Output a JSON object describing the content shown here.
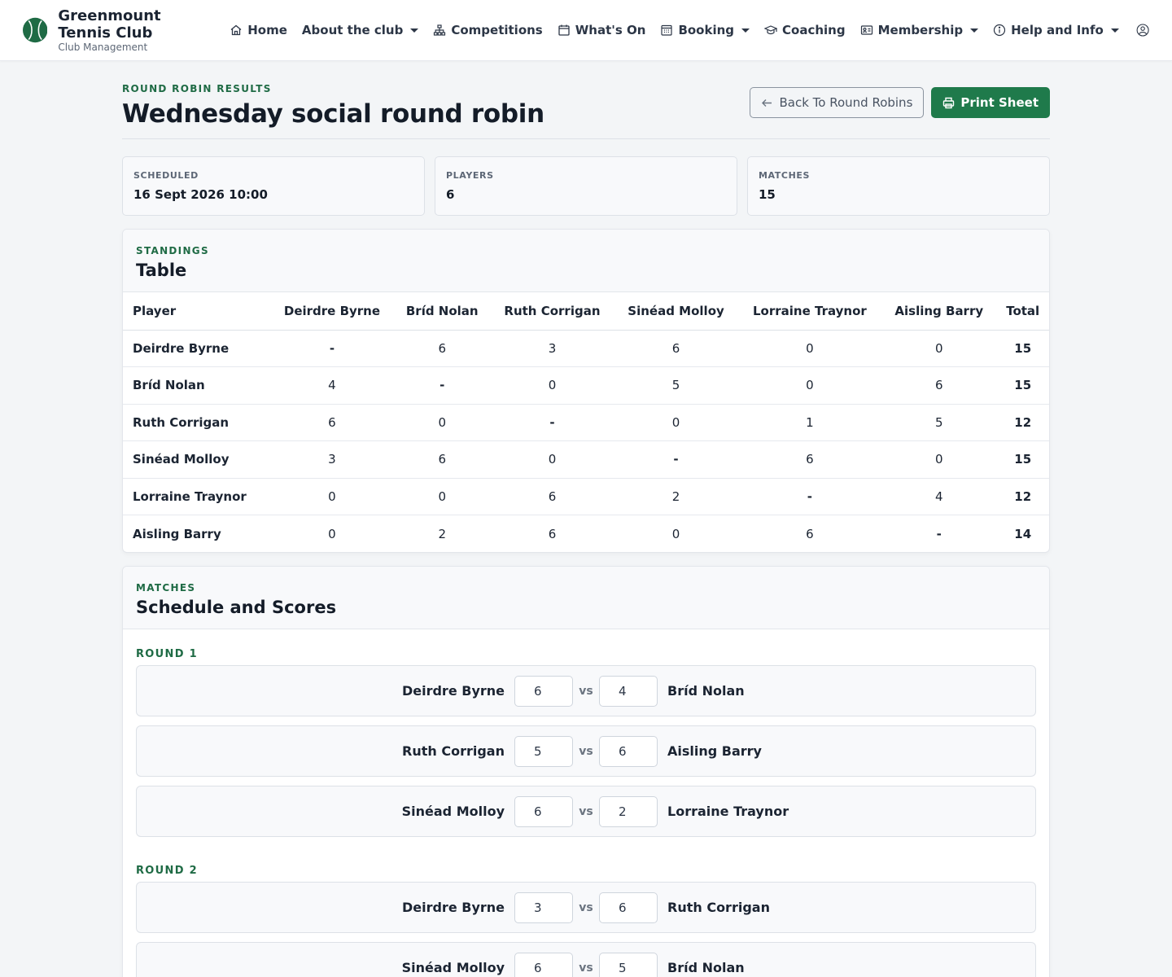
{
  "brand": {
    "title": "Greenmount Tennis Club",
    "subtitle": "Club Management"
  },
  "nav": {
    "home": "Home",
    "about": "About the club",
    "competitions": "Competitions",
    "whats_on": "What's On",
    "booking": "Booking",
    "coaching": "Coaching",
    "membership": "Membership",
    "help": "Help and Info"
  },
  "page": {
    "eyebrow": "Round Robin Results",
    "title": "Wednesday social round robin",
    "back_label": "Back To Round Robins",
    "print_label": "Print Sheet"
  },
  "stats": {
    "scheduled_label": "Scheduled",
    "scheduled_value": "16 Sept 2026 10:00",
    "players_label": "Players",
    "players_value": "6",
    "matches_label": "Matches",
    "matches_value": "15"
  },
  "standings": {
    "eyebrow": "Standings",
    "title": "Table",
    "player_header": "Player",
    "total_header": "Total",
    "columns": [
      "Deirdre Byrne",
      "Bríd Nolan",
      "Ruth Corrigan",
      "Sinéad Molloy",
      "Lorraine Traynor",
      "Aisling Barry"
    ],
    "rows": [
      {
        "player": "Deirdre Byrne",
        "scores": [
          "-",
          "6",
          "3",
          "6",
          "0",
          "0"
        ],
        "total": "15"
      },
      {
        "player": "Bríd Nolan",
        "scores": [
          "4",
          "-",
          "0",
          "5",
          "0",
          "6"
        ],
        "total": "15"
      },
      {
        "player": "Ruth Corrigan",
        "scores": [
          "6",
          "0",
          "-",
          "0",
          "1",
          "5"
        ],
        "total": "12"
      },
      {
        "player": "Sinéad Molloy",
        "scores": [
          "3",
          "6",
          "0",
          "-",
          "6",
          "0"
        ],
        "total": "15"
      },
      {
        "player": "Lorraine Traynor",
        "scores": [
          "0",
          "0",
          "6",
          "2",
          "-",
          "4"
        ],
        "total": "12"
      },
      {
        "player": "Aisling Barry",
        "scores": [
          "0",
          "2",
          "6",
          "0",
          "6",
          "-"
        ],
        "total": "14"
      }
    ]
  },
  "schedule": {
    "eyebrow": "Matches",
    "title": "Schedule and Scores",
    "vs_label": "vs",
    "rounds": [
      {
        "label": "Round 1",
        "matches": [
          {
            "home": "Deirdre Byrne",
            "home_score": "6",
            "away_score": "4",
            "away": "Bríd Nolan"
          },
          {
            "home": "Ruth Corrigan",
            "home_score": "5",
            "away_score": "6",
            "away": "Aisling Barry"
          },
          {
            "home": "Sinéad Molloy",
            "home_score": "6",
            "away_score": "2",
            "away": "Lorraine Traynor"
          }
        ]
      },
      {
        "label": "Round 2",
        "matches": [
          {
            "home": "Deirdre Byrne",
            "home_score": "3",
            "away_score": "6",
            "away": "Ruth Corrigan"
          },
          {
            "home": "Sinéad Molloy",
            "home_score": "6",
            "away_score": "5",
            "away": "Bríd Nolan"
          }
        ]
      }
    ]
  },
  "colors": {
    "accent": "#1f7a4b",
    "accent_text": "#1f6b45",
    "background": "#f3f5f7"
  }
}
